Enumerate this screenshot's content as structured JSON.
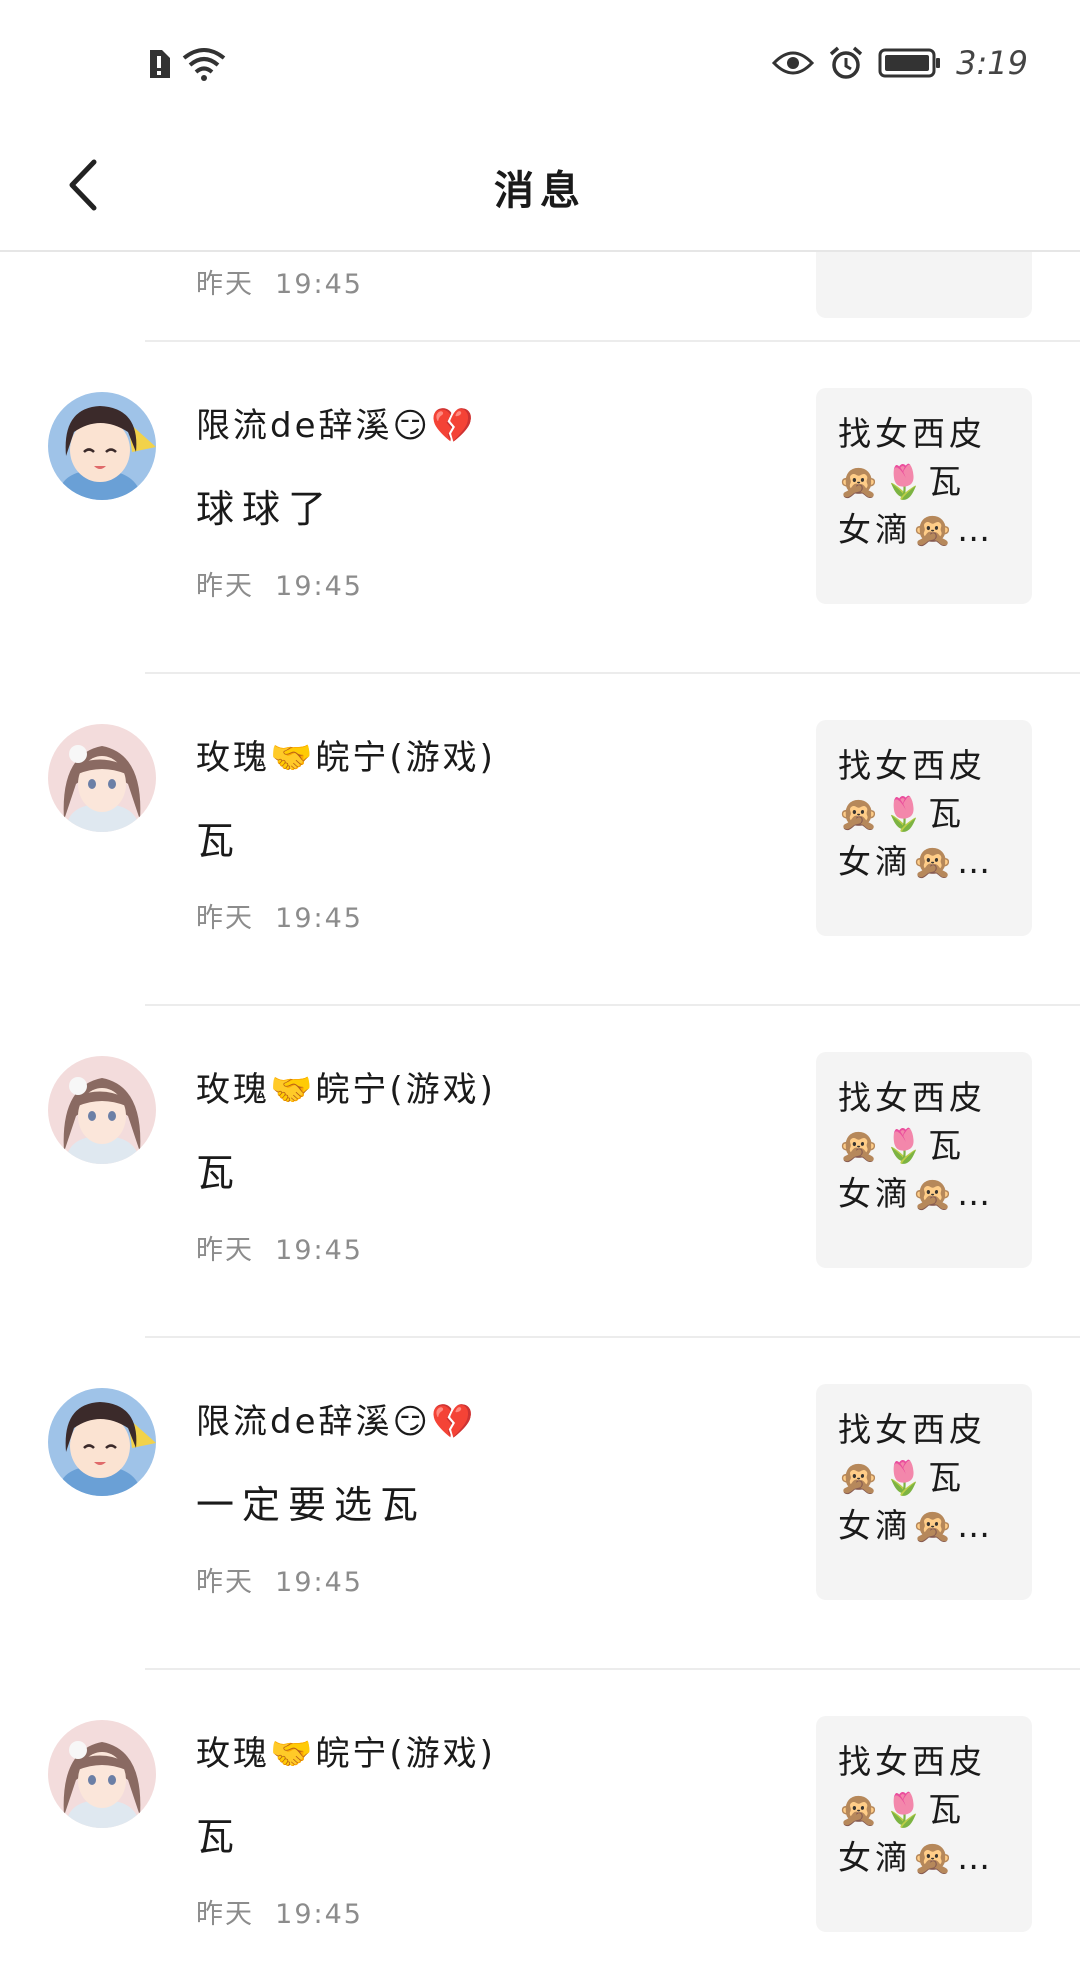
{
  "status_bar": {
    "time": "3:19",
    "icons": [
      "sim-alert-icon",
      "wifi-icon",
      "eye-icon",
      "alarm-icon",
      "battery-icon"
    ]
  },
  "header": {
    "title": "消息",
    "back_icon": "chevron-left-icon"
  },
  "partial_item": {
    "date": "昨天",
    "time": "19:45"
  },
  "items": [
    {
      "name": "限流de辞溪😏💔",
      "message": "球球了",
      "date": "昨天",
      "time": "19:45",
      "thumb_lines": [
        "找女西皮",
        "🙊🌷瓦",
        "女滴🙊…"
      ]
    },
    {
      "name": "玫瑰🤝皖宁(游戏)",
      "message": "瓦",
      "date": "昨天",
      "time": "19:45",
      "thumb_lines": [
        "找女西皮",
        "🙊🌷瓦",
        "女滴🙊…"
      ]
    },
    {
      "name": "玫瑰🤝皖宁(游戏)",
      "message": "瓦",
      "date": "昨天",
      "time": "19:45",
      "thumb_lines": [
        "找女西皮",
        "🙊🌷瓦",
        "女滴🙊…"
      ]
    },
    {
      "name": "限流de辞溪😏💔",
      "message": "一定要选瓦",
      "date": "昨天",
      "time": "19:45",
      "thumb_lines": [
        "找女西皮",
        "🙊🌷瓦",
        "女滴🙊…"
      ]
    },
    {
      "name": "玫瑰🤝皖宁(游戏)",
      "message": "瓦",
      "date": "昨天",
      "time": "19:45",
      "thumb_lines": [
        "找女西皮",
        "🙊🌷瓦",
        "女滴🙊…"
      ]
    }
  ]
}
